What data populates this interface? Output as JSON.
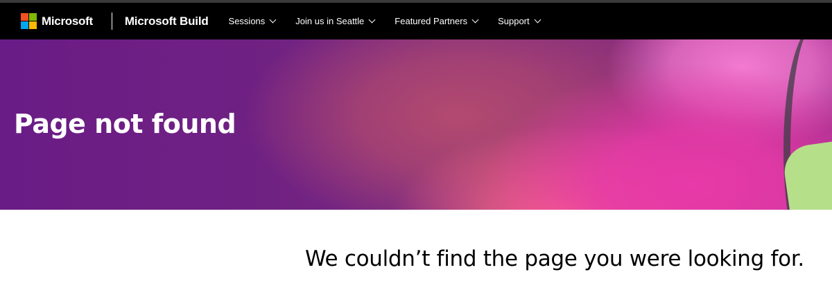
{
  "header": {
    "brand": {
      "text": "Microsoft",
      "logo_colors": [
        "#f25022",
        "#7fba00",
        "#00a4ef",
        "#ffb900"
      ]
    },
    "site_title": "Microsoft Build",
    "nav": [
      {
        "label": "Sessions",
        "icon": "chevron-down-icon"
      },
      {
        "label": "Join us in Seattle",
        "icon": "chevron-down-icon"
      },
      {
        "label": "Featured Partners",
        "icon": "chevron-down-icon"
      },
      {
        "label": "Support",
        "icon": "chevron-down-icon"
      }
    ]
  },
  "hero": {
    "title": "Page not found",
    "colors": {
      "base": "#6a1c86",
      "pink": "#e83aa8",
      "coral": "#ff6a86",
      "green": "#b6df8a"
    }
  },
  "main": {
    "message": "We couldn’t find the page you were looking for."
  }
}
